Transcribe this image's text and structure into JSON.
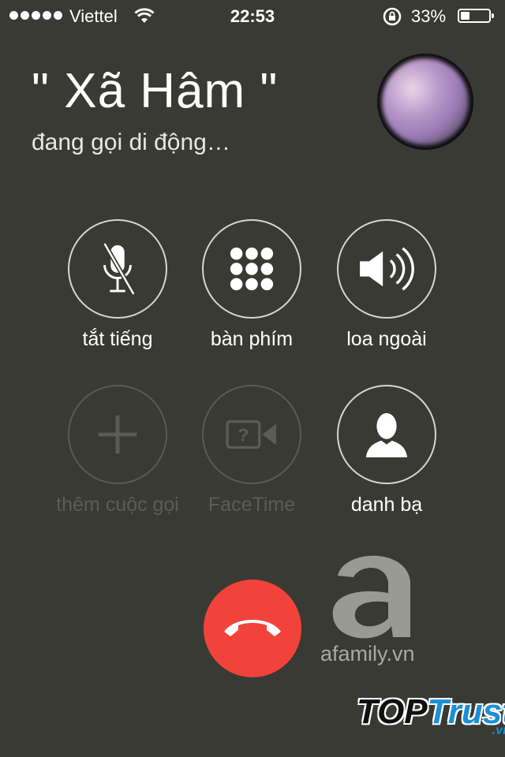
{
  "status_bar": {
    "carrier": "Viettel",
    "time": "22:53",
    "battery_percent": "33%",
    "battery_level": 0.33,
    "signal_bars": 5
  },
  "call": {
    "caller_name": "\" Xã Hâm \"",
    "status": "đang gọi di động…"
  },
  "controls": [
    {
      "label": "tắt tiếng",
      "icon": "mute-icon",
      "enabled": true
    },
    {
      "label": "bàn phím",
      "icon": "keypad-icon",
      "enabled": true
    },
    {
      "label": "loa ngoài",
      "icon": "speaker-icon",
      "enabled": true
    },
    {
      "label": "thêm cuộc gọi",
      "icon": "plus-icon",
      "enabled": false
    },
    {
      "label": "FaceTime",
      "icon": "facetime-icon",
      "enabled": false
    },
    {
      "label": "danh bạ",
      "icon": "contact-icon",
      "enabled": true
    }
  ],
  "end_call": {
    "icon": "hang-up-icon",
    "color": "#f2433a"
  },
  "watermarks": {
    "afamily": "afamily.vn",
    "toptrust_top": "TOP",
    "toptrust_trust": "Trust",
    "toptrust_vn": ".vn"
  }
}
